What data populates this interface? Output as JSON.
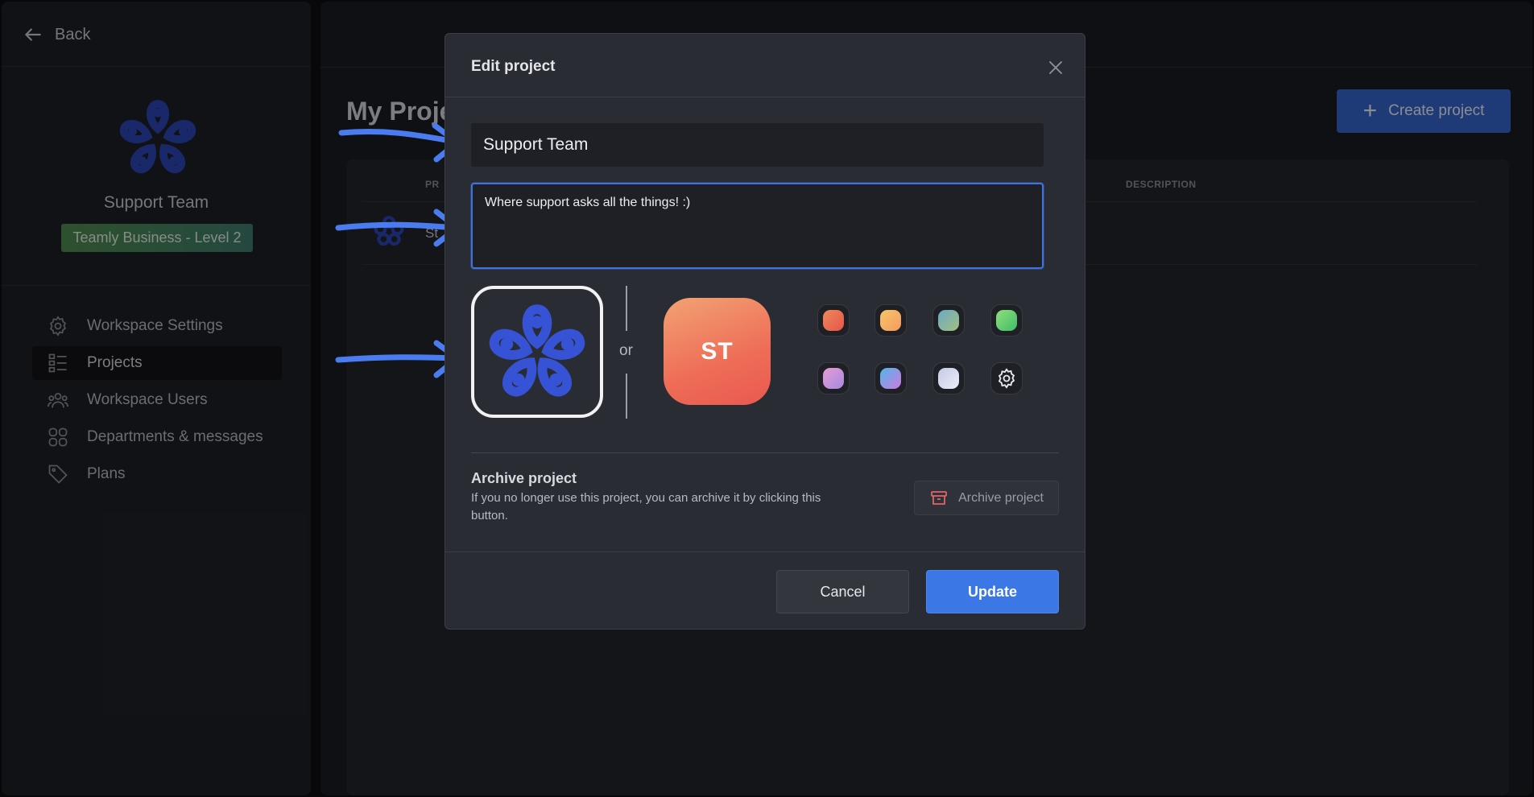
{
  "sidebar": {
    "back_label": "Back",
    "workspace_name": "Support Team",
    "plan_badge": "Teamly Business - Level 2",
    "items": [
      {
        "label": "Workspace Settings",
        "icon": "gear-icon"
      },
      {
        "label": "Projects",
        "icon": "list-icon"
      },
      {
        "label": "Workspace Users",
        "icon": "users-icon"
      },
      {
        "label": "Departments & messages",
        "icon": "grid-icon"
      },
      {
        "label": "Plans",
        "icon": "tag-icon"
      }
    ]
  },
  "main": {
    "title": "My Proje",
    "create_button": "Create project",
    "columns": {
      "project": "PR",
      "description": "DESCRIPTION"
    },
    "row_name": "St"
  },
  "modal": {
    "title": "Edit project",
    "name_value": "Support Team",
    "description_value": "Where support asks all the things! :)",
    "or_label": "or",
    "initials": "ST",
    "swatches": [
      {
        "gradient": [
          "#f0885a",
          "#e4564b"
        ]
      },
      {
        "gradient": [
          "#f7c56a",
          "#f49b5e"
        ]
      },
      {
        "gradient": [
          "#6aa9c6",
          "#a3c07d"
        ]
      },
      {
        "gradient": [
          "#8fe07a",
          "#3fbc6a"
        ]
      },
      {
        "gradient": [
          "#e59bd5",
          "#a78ae0"
        ]
      },
      {
        "gradient": [
          "#4fb6e8",
          "#d07ae0"
        ]
      },
      {
        "gradient": [
          "#c5c9e6",
          "#eceef6"
        ]
      }
    ],
    "settings_icon": "gear-icon",
    "archive": {
      "title": "Archive project",
      "description": "If you no longer use this project, you can archive it by clicking this button.",
      "button": "Archive project"
    },
    "cancel": "Cancel",
    "update": "Update"
  },
  "colors": {
    "accent": "#3b78e6",
    "logo_blue": "#2f4fc9",
    "annotation_arrow": "#4a7cf0"
  }
}
